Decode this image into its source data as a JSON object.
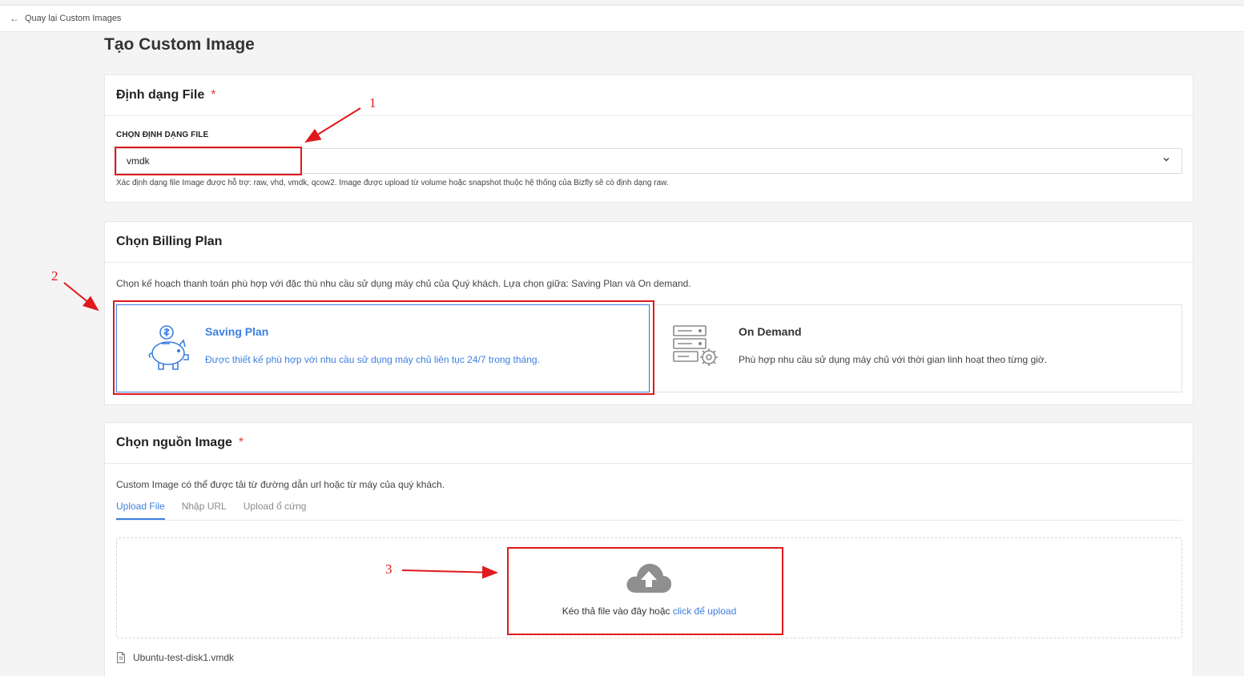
{
  "nav": {
    "back_label": "Quay lại Custom Images",
    "back_icon": "arrow-left-icon"
  },
  "page": {
    "title": "Tạo Custom Image"
  },
  "file_format": {
    "header": "Định dạng File",
    "required_mark": "*",
    "field_label": "CHỌN ĐỊNH DẠNG FILE",
    "selected_value": "vmdk",
    "hint": "Xác định dạng file Image được hỗ trợ: raw, vhd, vmdk, qcow2. Image được upload từ volume hoặc snapshot thuộc hệ thống của Bizfly sẽ có định dạng raw."
  },
  "billing": {
    "header": "Chọn Billing Plan",
    "description": "Chọn kế hoạch thanh toán phù hợp với đặc thù nhu cầu sử dụng máy chủ của Quý khách. Lựa chọn giữa: Saving Plan và On demand.",
    "plans": [
      {
        "title": "Saving Plan",
        "description": "Được thiết kế phù hợp với nhu cầu sử dụng máy chủ liên tục 24/7 trong tháng.",
        "icon": "piggy-bank-icon",
        "selected": true
      },
      {
        "title": "On Demand",
        "description": "Phù hợp nhu cầu sử dụng máy chủ với thời gian linh hoạt theo từng giờ.",
        "icon": "server-gear-icon",
        "selected": false
      }
    ]
  },
  "source": {
    "header": "Chọn nguồn Image",
    "required_mark": "*",
    "description": "Custom Image có thể được tải từ đường dẫn url hoặc từ máy của quý khách.",
    "tabs": [
      {
        "label": "Upload File",
        "active": true
      },
      {
        "label": "Nhập URL",
        "active": false
      },
      {
        "label": "Upload ổ cứng",
        "active": false
      }
    ],
    "dropzone": {
      "text": "Kéo thả file vào đây hoặc",
      "link": "click để upload",
      "icon": "cloud-upload-icon"
    },
    "uploaded_file": {
      "name": "Ubuntu-test-disk1.vmdk",
      "icon": "file-icon"
    }
  },
  "annotations": {
    "one": "1",
    "two": "2",
    "three": "3",
    "color": "#e0191c"
  },
  "colors": {
    "accent": "#3d7fe0",
    "required": "#e53935",
    "background": "#f4f4f4"
  }
}
